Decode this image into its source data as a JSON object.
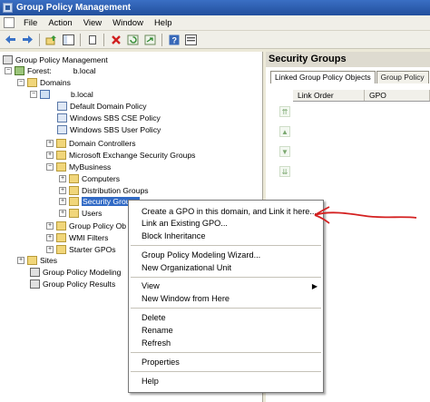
{
  "window": {
    "title": "Group Policy Management"
  },
  "menu": [
    "File",
    "Action",
    "View",
    "Window",
    "Help"
  ],
  "toolbar_icons": [
    "back-arrow-icon",
    "forward-arrow-icon",
    "up-icon",
    "show-hide-tree-icon",
    "copy-icon",
    "delete-icon",
    "refresh-icon",
    "export-icon",
    "help-icon",
    "properties-icon"
  ],
  "tree": {
    "root": "Group Policy Management",
    "forest": "Forest:",
    "forest_suffix": "b.local",
    "domains": "Domains",
    "domain_name": "b.local",
    "default_domain_policy": "Default Domain Policy",
    "sbs_cse": "Windows SBS CSE Policy",
    "sbs_user": "Windows SBS User Policy",
    "domain_controllers": "Domain Controllers",
    "exchange": "Microsoft Exchange Security Groups",
    "mybusiness": "MyBusiness",
    "computers": "Computers",
    "distribution": "Distribution Groups",
    "security": "Security Groups",
    "users": "Users",
    "gpo_objects": "Group Policy Ob",
    "wmi": "WMI Filters",
    "starter": "Starter GPOs",
    "sites": "Sites",
    "modeling": "Group Policy Modeling",
    "results": "Group Policy Results"
  },
  "right_pane": {
    "title": "Security Groups",
    "tabs": [
      "Linked Group Policy Objects",
      "Group Policy"
    ],
    "columns": [
      "Link Order",
      "GPO"
    ]
  },
  "context_menu": {
    "create_gpo": "Create a GPO in this domain, and Link it here...",
    "link_existing": "Link an Existing GPO...",
    "block": "Block Inheritance",
    "modeling_wizard": "Group Policy Modeling Wizard...",
    "new_ou": "New Organizational Unit",
    "view": "View",
    "new_window": "New Window from Here",
    "delete": "Delete",
    "rename": "Rename",
    "refresh": "Refresh",
    "properties": "Properties",
    "help": "Help"
  },
  "colors": {
    "title_bar": "#224f9c",
    "selection": "#316ac5",
    "annotation_arrow": "#d42020"
  }
}
